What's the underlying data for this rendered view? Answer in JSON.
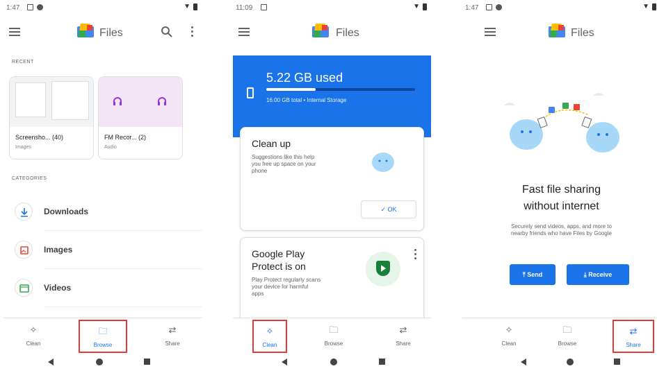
{
  "screens": [
    {
      "status_time": "1:47",
      "app_title": "Files",
      "recent_label": "RECENT",
      "recent": [
        {
          "name": "Screensho...",
          "count": "(40)",
          "type": "Images"
        },
        {
          "name": "FM Recor...",
          "count": "(2)",
          "type": "Audio"
        }
      ],
      "categories_label": "CATEGORIES",
      "categories": [
        {
          "label": "Downloads",
          "icon": "download-icon",
          "color": "#1a73e8"
        },
        {
          "label": "Images",
          "icon": "image-icon",
          "color": "#ea4335"
        },
        {
          "label": "Videos",
          "icon": "video-icon",
          "color": "#34a853"
        }
      ],
      "nav": [
        "Clean",
        "Browse",
        "Share"
      ],
      "active_nav": "Browse"
    },
    {
      "status_time": "11:09",
      "app_title": "Files",
      "storage": {
        "used": "5.22 GB used",
        "total": "16.00 GB total • Internal Storage",
        "fraction_used": 0.33
      },
      "clean_card": {
        "title": "Clean up",
        "desc": "Suggestions like this help you free up space on your phone",
        "ok": "OK"
      },
      "protect_card": {
        "title": "Google Play Protect is on",
        "desc": "Play Protect regularly scans your device for harmful apps"
      },
      "nav": [
        "Clean",
        "Browse",
        "Share"
      ],
      "active_nav": "Clean"
    },
    {
      "status_time": "1:47",
      "app_title": "Files",
      "headline": "Fast file sharing without internet",
      "desc": "Securely send videos, apps, and more to nearby friends who have Files by Google",
      "send": "Send",
      "receive": "Receive",
      "nav": [
        "Clean",
        "Browse",
        "Share"
      ],
      "active_nav": "Share"
    }
  ],
  "colors": {
    "accent": "#1a73e8",
    "highlight": "#e53935"
  }
}
